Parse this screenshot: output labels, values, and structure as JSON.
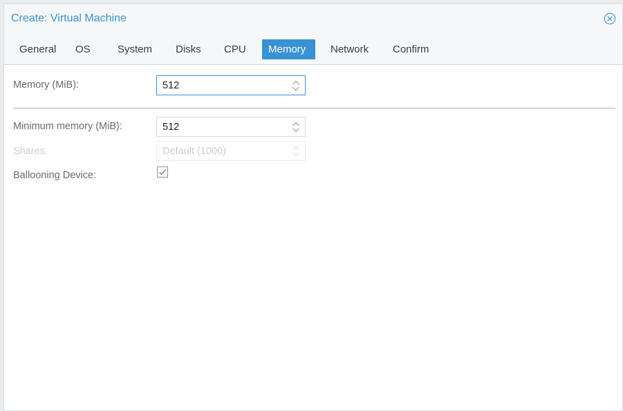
{
  "window": {
    "title": "Create: Virtual Machine"
  },
  "tabs": [
    {
      "label": "General",
      "active": false
    },
    {
      "label": "OS",
      "active": false
    },
    {
      "label": "System",
      "active": false
    },
    {
      "label": "Disks",
      "active": false
    },
    {
      "label": "CPU",
      "active": false
    },
    {
      "label": "Memory",
      "active": true
    },
    {
      "label": "Network",
      "active": false
    },
    {
      "label": "Confirm",
      "active": false
    }
  ],
  "form": {
    "memory": {
      "label": "Memory (MiB):",
      "value": "512"
    },
    "min_memory": {
      "label": "Minimum memory (MiB):",
      "value": "512"
    },
    "shares": {
      "label": "Shares:",
      "placeholder": "Default (1000)",
      "disabled": true
    },
    "ballooning": {
      "label": "Ballooning Device:",
      "checked": true
    }
  },
  "colors": {
    "accent": "#3892d4",
    "label": "#666b70",
    "disabled": "#c8ccd0"
  },
  "icons": {
    "close": "close-circle-icon",
    "spinner": "up-down-chevron-icon",
    "checkbox": "checkmark-icon"
  }
}
